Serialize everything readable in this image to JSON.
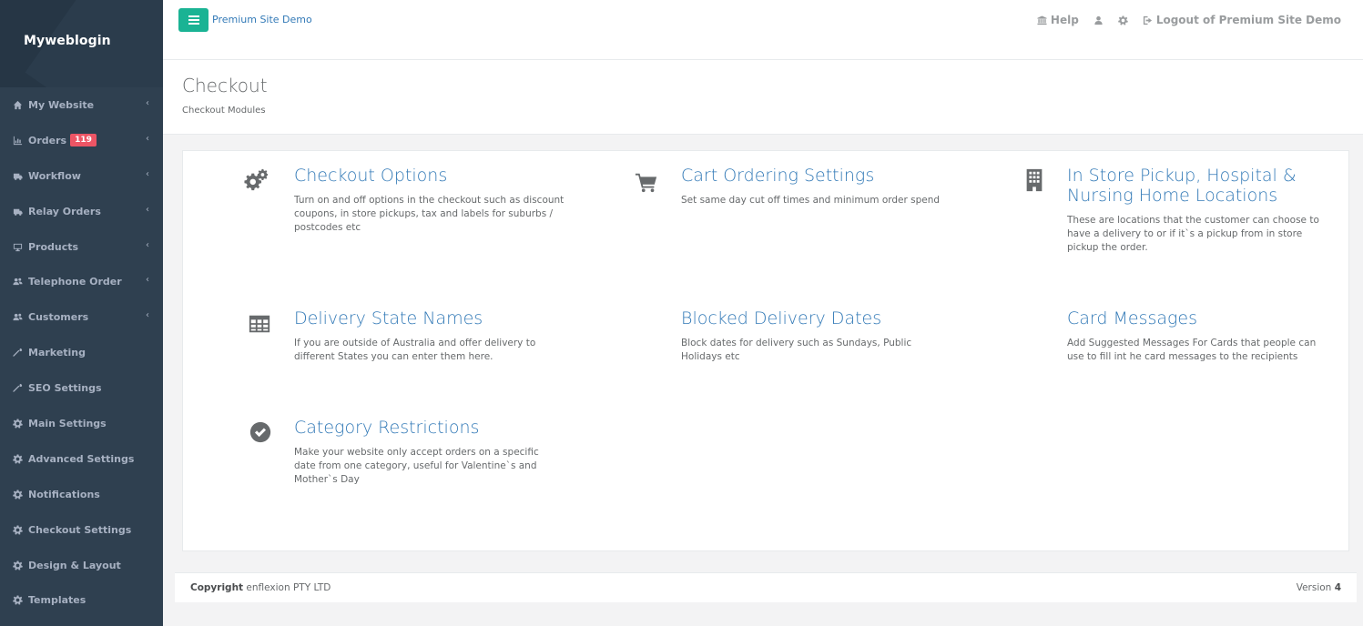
{
  "sidebar": {
    "brand": "Myweblogin",
    "items": [
      {
        "label": "My Website",
        "icon": "home-icon",
        "arrow": "‹"
      },
      {
        "label": "Orders",
        "icon": "bar-chart-icon",
        "badge": "119",
        "arrow": "‹"
      },
      {
        "label": "Workflow",
        "icon": "truck-icon",
        "arrow": "‹"
      },
      {
        "label": "Relay Orders",
        "icon": "truck-icon",
        "arrow": "‹"
      },
      {
        "label": "Products",
        "icon": "monitor-icon",
        "arrow": "‹"
      },
      {
        "label": "Telephone Order",
        "icon": "users-icon",
        "arrow": "‹"
      },
      {
        "label": "Customers",
        "icon": "users-icon",
        "arrow": "‹"
      },
      {
        "label": "Marketing",
        "icon": "wrench-icon"
      },
      {
        "label": "SEO Settings",
        "icon": "wrench-icon"
      },
      {
        "label": "Main Settings",
        "icon": "gear-icon"
      },
      {
        "label": "Advanced Settings",
        "icon": "gear-icon"
      },
      {
        "label": "Notifications",
        "icon": "gear-icon"
      },
      {
        "label": "Checkout Settings",
        "icon": "gear-icon"
      },
      {
        "label": "Design & Layout",
        "icon": "gear-icon"
      },
      {
        "label": "Templates",
        "icon": "gear-icon"
      }
    ]
  },
  "topbar": {
    "site_name": "Premium Site Demo",
    "help": "Help",
    "logout": "Logout of Premium Site Demo",
    "accent": "#1ab394"
  },
  "heading": {
    "title": "Checkout",
    "subtitle": "Checkout Modules"
  },
  "modules": [
    {
      "title": "Checkout Options",
      "desc": "Turn on and off options in the checkout such as discount coupons, in store pickups, tax and labels for suburbs / postcodes etc",
      "icon": "gears-icon"
    },
    {
      "title": "Cart Ordering Settings",
      "desc": "Set same day cut off times and minimum order spend",
      "icon": "cart-icon"
    },
    {
      "title": "In Store Pickup, Hospital & Nursing Home Locations",
      "desc": "These are locations that the customer can choose to have a delivery to or if it`s a pickup from in store pickup the order.",
      "icon": "building-icon"
    },
    {
      "title": "Delivery State Names",
      "desc": "If you are outside of Australia and offer delivery to different States you can enter them here.",
      "icon": "table-icon"
    },
    {
      "title": "Blocked Delivery Dates",
      "desc": "Block dates for delivery such as Sundays, Public Holidays etc",
      "icon": ""
    },
    {
      "title": "Card Messages",
      "desc": "Add Suggested Messages For Cards that people can use to fill int he card messages to the recipients",
      "icon": ""
    },
    {
      "title": "Category Restrictions",
      "desc": "Make your website only accept orders on a specific date from one category, useful for Valentine`s and Mother`s Day",
      "icon": "check-circle-icon"
    }
  ],
  "footer": {
    "copyright_label": "Copyright",
    "company": "enflexion PTY LTD",
    "version_label": "Version",
    "version": "4"
  }
}
